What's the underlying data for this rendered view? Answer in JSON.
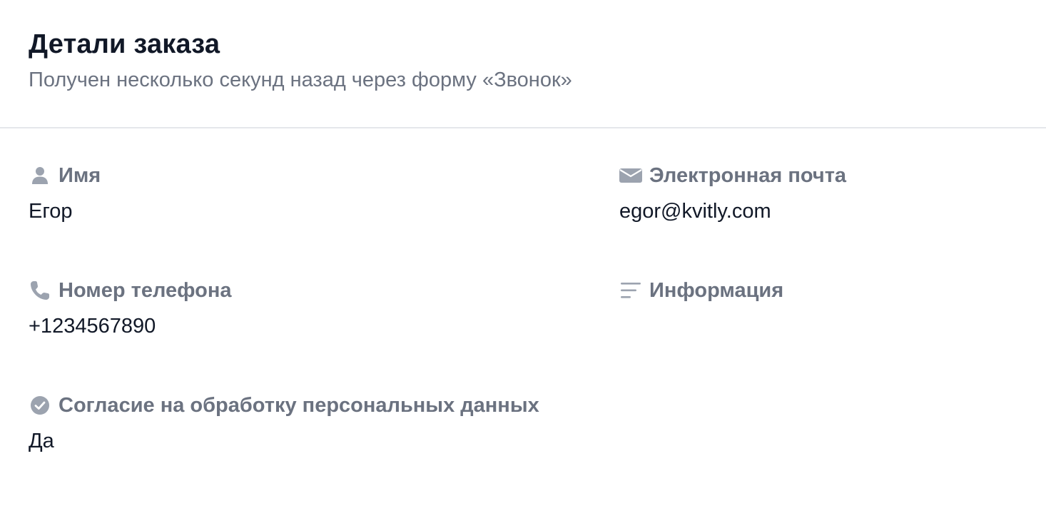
{
  "header": {
    "title": "Детали заказа",
    "subtitle": "Получен несколько секунд назад через форму «Звонок»"
  },
  "fields": {
    "name": {
      "label": "Имя",
      "value": "Егор",
      "icon": "user-icon"
    },
    "email": {
      "label": "Электронная почта",
      "value": "egor@kvitly.com",
      "icon": "envelope-icon"
    },
    "phone": {
      "label": "Номер телефона",
      "value": "+1234567890",
      "icon": "phone-icon"
    },
    "info": {
      "label": "Информация",
      "value": "",
      "icon": "text-lines-icon"
    },
    "consent": {
      "label": "Согласие на обработку персональных данных",
      "value": "Да",
      "icon": "check-circle-icon"
    }
  },
  "colors": {
    "label": "#6b7280",
    "value": "#111827",
    "icon": "#9ca3af",
    "divider": "#e5e7eb"
  }
}
